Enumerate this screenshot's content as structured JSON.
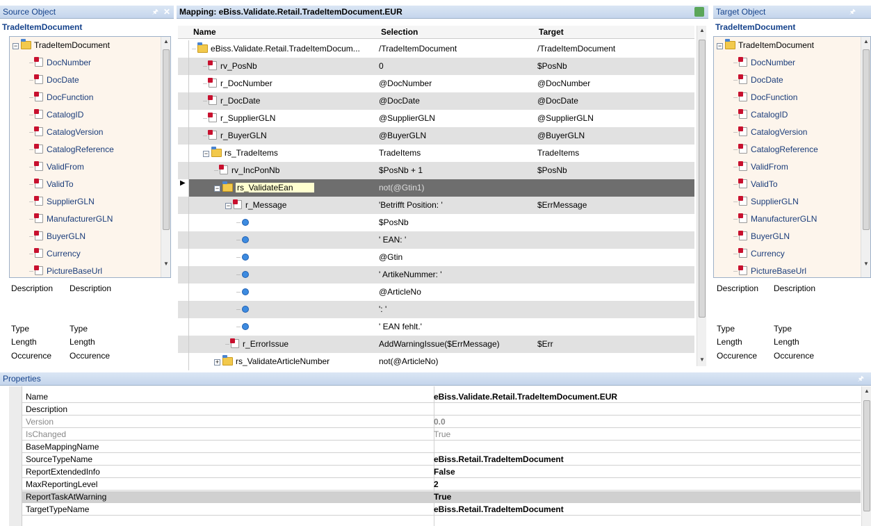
{
  "source_panel": {
    "title": "Source Object",
    "subtitle": "TradeItemDocument",
    "root": "TradeItemDocument",
    "items": [
      "DocNumber",
      "DocDate",
      "DocFunction",
      "CatalogID",
      "CatalogVersion",
      "CatalogReference",
      "ValidFrom",
      "ValidTo",
      "SupplierGLN",
      "ManufacturerGLN",
      "BuyerGLN",
      "Currency",
      "PictureBaseUrl"
    ],
    "desc_label": "Description",
    "desc_value": "Description",
    "type_label": "Type",
    "type_value": "Type",
    "length_label": "Length",
    "length_value": "Length",
    "occ_label": "Occurence",
    "occ_value": "Occurence"
  },
  "target_panel": {
    "title": "Target Object",
    "subtitle": "TradeItemDocument",
    "root": "TradeItemDocument",
    "items": [
      "DocNumber",
      "DocDate",
      "DocFunction",
      "CatalogID",
      "CatalogVersion",
      "CatalogReference",
      "ValidFrom",
      "ValidTo",
      "SupplierGLN",
      "ManufacturerGLN",
      "BuyerGLN",
      "Currency",
      "PictureBaseUrl"
    ],
    "desc_label": "Description",
    "desc_value": "Description",
    "type_label": "Type",
    "type_value": "Type",
    "length_label": "Length",
    "length_value": "Length",
    "occ_label": "Occurence",
    "occ_value": "Occurence"
  },
  "mapping": {
    "title": "Mapping: eBiss.Validate.Retail.TradeItemDocument.EUR",
    "col_name": "Name",
    "col_selection": "Selection",
    "col_target": "Target",
    "rows": [
      {
        "name": "eBiss.Validate.Retail.TradeItemDocum...",
        "selection": "/TradeItemDocument",
        "target": "/TradeItemDocument",
        "icon": "folder"
      },
      {
        "name": "rv_PosNb",
        "selection": "0",
        "target": "$PosNb",
        "icon": "field"
      },
      {
        "name": "r_DocNumber",
        "selection": "@DocNumber",
        "target": "@DocNumber",
        "icon": "field"
      },
      {
        "name": "r_DocDate",
        "selection": "@DocDate",
        "target": "@DocDate",
        "icon": "field"
      },
      {
        "name": "r_SupplierGLN",
        "selection": "@SupplierGLN",
        "target": "@SupplierGLN",
        "icon": "field"
      },
      {
        "name": "r_BuyerGLN",
        "selection": "@BuyerGLN",
        "target": "@BuyerGLN",
        "icon": "field"
      },
      {
        "name": "rs_TradeItems",
        "selection": "TradeItems",
        "target": "TradeItems",
        "icon": "folder"
      },
      {
        "name": "rv_IncPonNb",
        "selection": "$PosNb + 1",
        "target": "$PosNb",
        "icon": "field"
      },
      {
        "name": "rs_ValidateEan",
        "selection": "not(@Gtin1)",
        "target": "",
        "icon": "folder"
      },
      {
        "name": "r_Message",
        "selection": "'Betrifft Position: '",
        "target": "$ErrMessage",
        "icon": "field"
      },
      {
        "name": "",
        "selection": "$PosNb",
        "target": "",
        "icon": "dot"
      },
      {
        "name": "",
        "selection": "' EAN: '",
        "target": "",
        "icon": "dot"
      },
      {
        "name": "",
        "selection": "@Gtin",
        "target": "",
        "icon": "dot"
      },
      {
        "name": "",
        "selection": "' ArtikeNummer: '",
        "target": "",
        "icon": "dot"
      },
      {
        "name": "",
        "selection": "@ArticleNo",
        "target": "",
        "icon": "dot"
      },
      {
        "name": "",
        "selection": "': '",
        "target": "",
        "icon": "dot"
      },
      {
        "name": "",
        "selection": "' EAN fehlt.'",
        "target": "",
        "icon": "dot"
      },
      {
        "name": "r_ErrorIssue",
        "selection": "AddWarningIssue($ErrMessage)",
        "target": "$Err",
        "icon": "field"
      },
      {
        "name": "rs_ValidateArticleNumber",
        "selection": "not(@ArticleNo)",
        "target": "",
        "icon": "folder"
      }
    ]
  },
  "properties": {
    "title": "Properties",
    "rows": [
      {
        "key": "Name",
        "value": "eBiss.Validate.Retail.TradeItemDocument.EUR"
      },
      {
        "key": "Description",
        "value": ""
      },
      {
        "key": "Version",
        "value": "0.0"
      },
      {
        "key": "IsChanged",
        "value": "True"
      },
      {
        "key": "BaseMappingName",
        "value": ""
      },
      {
        "key": "SourceTypeName",
        "value": "eBiss.Retail.TradeItemDocument"
      },
      {
        "key": "ReportExtendedInfo",
        "value": "False"
      },
      {
        "key": "MaxReportingLevel",
        "value": "2"
      },
      {
        "key": "ReportTaskAtWarning",
        "value": "True"
      },
      {
        "key": "TargetTypeName",
        "value": "eBiss.Retail.TradeItemDocument"
      }
    ]
  }
}
